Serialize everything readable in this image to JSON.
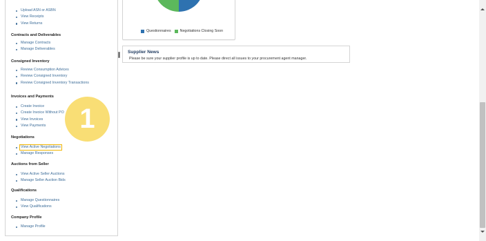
{
  "sidebar": {
    "top_items": [
      {
        "label": "Upload ASN or ASBN"
      },
      {
        "label": "View Receipts"
      },
      {
        "label": "View Returns"
      }
    ],
    "sections": [
      {
        "title": "Contracts and Deliverables",
        "items": [
          "Manage Contracts",
          "Manage Deliverables"
        ]
      },
      {
        "title": "Consigned Inventory",
        "items": [
          "Review Consumption Advices",
          "Review Consigned Inventory",
          "Review Consigned Inventory Transactions"
        ]
      },
      {
        "title": "Invoices and Payments",
        "items": [
          "Create Invoice",
          "Create Invoice Without PO",
          "View Invoices",
          "View Payments"
        ]
      },
      {
        "title": "Negotiations",
        "items": [
          "View Active Negotiations",
          "Manage Responses"
        ]
      },
      {
        "title": "Auctions from Seller",
        "items": [
          "View Active Seller Auctions",
          "Manage Seller Auction Bids"
        ]
      },
      {
        "title": "Qualifications",
        "items": [
          "Manage Questionnaires",
          "View Qualifications"
        ]
      },
      {
        "title": "Company Profile",
        "items": [
          "Manage Profile"
        ]
      }
    ]
  },
  "chart": {
    "legend": [
      {
        "label": "Questionnaires",
        "color": "#2e72b0"
      },
      {
        "label": "Negotiations Closing Soon",
        "color": "#5cb85c"
      }
    ]
  },
  "chart_data": {
    "type": "pie",
    "categories": [
      "Questionnaires",
      "Negotiations Closing Soon"
    ],
    "values": [
      50,
      50
    ],
    "title": "",
    "colors": [
      "#2e72b0",
      "#5cb85c"
    ]
  },
  "news": {
    "title": "Supplier News",
    "message": "Please be sure your supplier profile is up to date.  Please direct all issues to your procurement agent manager."
  },
  "callout": {
    "number": "1",
    "color": "#f9dc6a"
  }
}
